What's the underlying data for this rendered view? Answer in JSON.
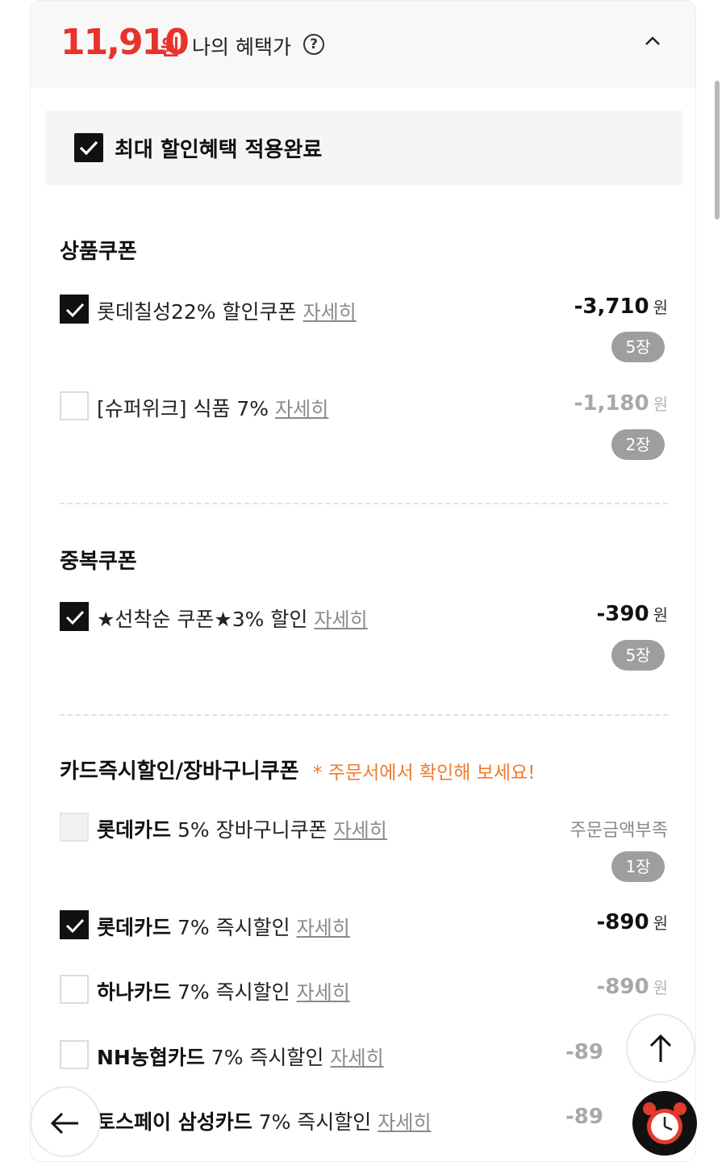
{
  "header": {
    "price": "11,910",
    "price_unit": "원",
    "benefit_label": "나의 혜택가",
    "help_glyph": "?",
    "collapse_icon": "chevron-up-icon"
  },
  "max_discount": {
    "checked": true,
    "label": "최대 할인혜택 적용완료"
  },
  "sections": {
    "product_coupons": {
      "title": "상품쿠폰",
      "items": [
        {
          "brand": "",
          "label": "롯데칠성22% 할인쿠폰",
          "detail": "자세히",
          "checked": true,
          "amount": "-3,710",
          "unit": "원",
          "count": "5장"
        },
        {
          "brand": "",
          "label": "[슈퍼위크] 식품 7%",
          "detail": "자세히",
          "checked": false,
          "amount": "-1,180",
          "unit": "원",
          "count": "2장"
        }
      ]
    },
    "duplicate_coupons": {
      "title": "중복쿠폰",
      "items": [
        {
          "brand": "",
          "label": "★선착순 쿠폰★3% 할인",
          "detail": "자세히",
          "checked": true,
          "amount": "-390",
          "unit": "원",
          "count": "5장"
        }
      ]
    },
    "card_discounts": {
      "title": "카드즉시할인/장바구니쿠폰",
      "notice": "* 주문서에서 확인해 보세요!",
      "items": [
        {
          "brand": "롯데카드",
          "label": " 5% 장바구니쿠폰",
          "detail": "자세히",
          "checked": false,
          "disabled": true,
          "status": "주문금액부족",
          "count": "1장"
        },
        {
          "brand": "롯데카드",
          "label": " 7% 즉시할인",
          "detail": "자세히",
          "checked": true,
          "amount": "-890",
          "unit": "원"
        },
        {
          "brand": "하나카드",
          "label": " 7% 즉시할인",
          "detail": "자세히",
          "checked": false,
          "amount": "-890",
          "unit": "원"
        },
        {
          "brand": "NH농협카드",
          "label": " 7% 즉시할인",
          "detail": "자세히",
          "checked": false,
          "amount": "-89",
          "unit": ""
        },
        {
          "brand": "토스페이 삼성카드",
          "label": " 7% 즉시할인",
          "detail": "자세히",
          "checked": false,
          "amount": "-89",
          "unit": ""
        }
      ]
    }
  },
  "floating": {
    "scroll_top_icon": "arrow-up-icon",
    "back_icon": "arrow-left-icon",
    "alarm_icon": "alarm-clock-icon"
  }
}
